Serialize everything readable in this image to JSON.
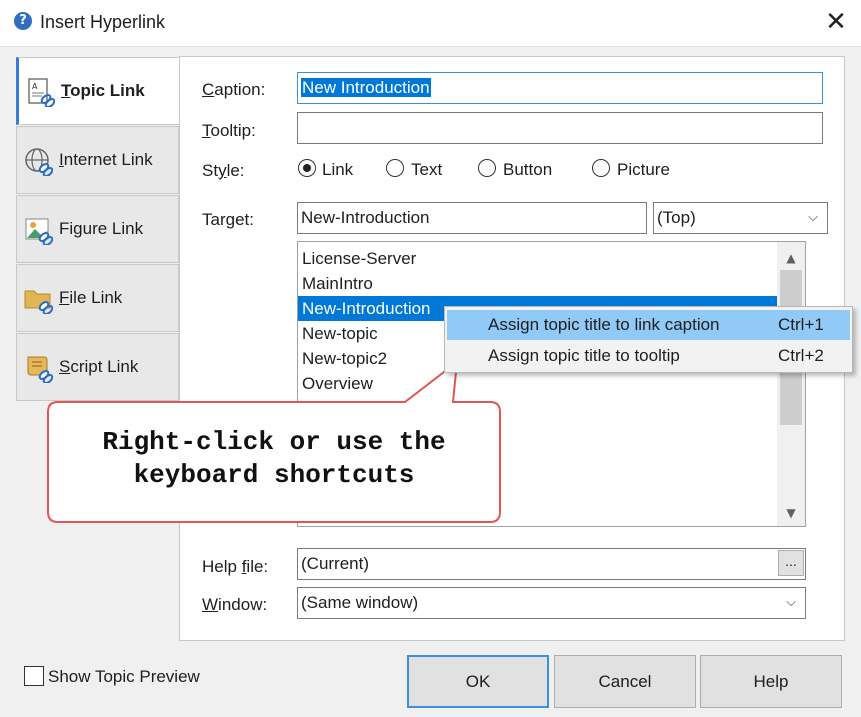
{
  "window": {
    "title": "Insert Hyperlink",
    "close_glyph": "✕",
    "icon": "app-help-icon"
  },
  "tabs": [
    {
      "label": "Topic Link",
      "icon": "topic-link-icon",
      "active": true
    },
    {
      "label": "Internet Link",
      "icon": "globe-link-icon",
      "active": false
    },
    {
      "label": "Figure Link",
      "icon": "figure-link-icon",
      "active": false
    },
    {
      "label": "File Link",
      "icon": "folder-link-icon",
      "active": false
    },
    {
      "label": "Script Link",
      "icon": "script-link-icon",
      "active": false
    }
  ],
  "form": {
    "caption_label": "Caption:",
    "caption_value": "New Introduction",
    "tooltip_label": "Tooltip:",
    "tooltip_value": "",
    "style_label": "Style:",
    "style_options": [
      "Link",
      "Text",
      "Button",
      "Picture"
    ],
    "style_selected": "Link",
    "target_label": "Target:",
    "target_value": "New-Introduction",
    "target_frame": "(Top)",
    "help_file_label": "Help file:",
    "help_file_value": "(Current)",
    "browse_label": "...",
    "window_label": "Window:",
    "window_value": "(Same window)"
  },
  "topic_list": [
    "License-Server",
    "MainIntro",
    "New-Introduction",
    "New-topic",
    "New-topic2",
    "Overview"
  ],
  "topic_selected": "New-Introduction",
  "context_menu": [
    {
      "label": "Assign topic title to link caption",
      "shortcut": "Ctrl+1"
    },
    {
      "label": "Assign topic title to tooltip",
      "shortcut": "Ctrl+2"
    }
  ],
  "callout": {
    "line1": "Right-click or use the",
    "line2": "keyboard shortcuts"
  },
  "footer": {
    "preview_label": "Show Topic Preview",
    "preview_checked": false,
    "ok_label": "OK",
    "cancel_label": "Cancel",
    "help_label": "Help"
  },
  "colors": {
    "selection": "#0078d7",
    "menu_highlight": "#91c9f7",
    "callout_border": "#e05555",
    "focus_border": "#3c8fd8"
  }
}
